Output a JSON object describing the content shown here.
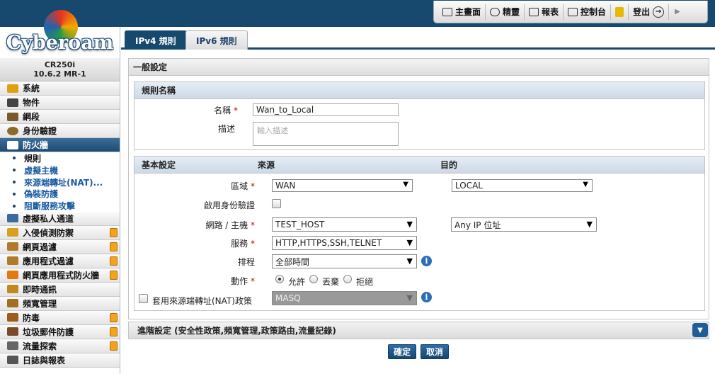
{
  "toolbar": {
    "items": [
      {
        "label": "主畫面",
        "icon": "monitor-icon"
      },
      {
        "label": "精靈",
        "icon": "chat-icon"
      },
      {
        "label": "報表",
        "icon": "report-icon"
      },
      {
        "label": "控制台",
        "icon": "console-icon"
      },
      {
        "label": "",
        "icon": "lock-icon"
      },
      {
        "label": "登出",
        "icon": "logout-icon"
      }
    ]
  },
  "logo": {
    "text": "Cyberoam"
  },
  "device": {
    "model": "CR250i",
    "version": "10.6.2 MR-1"
  },
  "menu": [
    {
      "label": "系統",
      "icon": "system-icon",
      "color": "#e0a010"
    },
    {
      "label": "物件",
      "icon": "objects-icon",
      "color": "#444"
    },
    {
      "label": "網段",
      "icon": "network-icon",
      "color": "#7a5a2a"
    },
    {
      "label": "身份驗證",
      "icon": "identity-icon",
      "color": "#8a6a2a"
    },
    {
      "label": "防火牆",
      "icon": "firewall-icon",
      "color": "#fff"
    }
  ],
  "submenu": [
    "規則",
    "虛擬主機",
    "來源端轉址(NAT)...",
    "偽裝防護",
    "阻斷服務攻擊"
  ],
  "menu2": [
    {
      "label": "虛擬私人通道",
      "icon": "vpn-icon",
      "color": "#3a6aa0",
      "locked": false
    },
    {
      "label": "入侵偵測防禦",
      "icon": "ips-icon",
      "color": "#d8a020",
      "locked": true
    },
    {
      "label": "網頁過濾",
      "icon": "web-filter-icon",
      "color": "#b07a2a",
      "locked": true
    },
    {
      "label": "應用程式過濾",
      "icon": "app-filter-icon",
      "color": "#b07a2a",
      "locked": true
    },
    {
      "label": "網頁應用程式防火牆",
      "icon": "waf-icon",
      "color": "#e07a10",
      "locked": true
    },
    {
      "label": "即時通訊",
      "icon": "im-icon",
      "color": "#c08a20",
      "locked": false
    },
    {
      "label": "頻寬管理",
      "icon": "bandwidth-icon",
      "color": "#a07020",
      "locked": false
    },
    {
      "label": "防毒",
      "icon": "antivirus-icon",
      "color": "#a05a1a",
      "locked": true
    },
    {
      "label": "垃圾郵件防護",
      "icon": "antispam-icon",
      "color": "#7a4a2a",
      "locked": true
    },
    {
      "label": "流量探索",
      "icon": "traffic-icon",
      "color": "#666",
      "locked": true
    },
    {
      "label": "日誌與報表",
      "icon": "logs-icon",
      "color": "#555",
      "locked": false
    }
  ],
  "tabs": [
    "IPv4 規則",
    "IPv6 規則"
  ],
  "general": {
    "title": "一般設定"
  },
  "rulename": {
    "section": "規則名稱",
    "name_label": "名稱",
    "name_value": "Wan_to_Local",
    "desc_label": "描述",
    "desc_placeholder": "輸入描述"
  },
  "basic": {
    "section": "基本設定",
    "source_col": "來源",
    "dest_col": "目的",
    "zone_label": "區域",
    "src_zone": "WAN",
    "dst_zone": "LOCAL",
    "identity_label": "啟用身份驗證",
    "network_label": "網路 / 主機",
    "src_network": "TEST_HOST",
    "dst_network": "Any IP 位址",
    "service_label": "服務",
    "service_value": "HTTP,HTTPS,SSH,TELNET",
    "schedule_label": "排程",
    "schedule_value": "全部時間",
    "action_label": "動作",
    "actions": [
      "允許",
      "丟棄",
      "拒絕"
    ],
    "selected_action": "允許",
    "nat_label": "套用來源端轉址(NAT)政策",
    "nat_value": "MASQ"
  },
  "advanced": {
    "label": "進階設定 (安全性政策,頻寬管理,政策路由,流量記錄)"
  },
  "buttons": {
    "ok": "確定",
    "cancel": "取消"
  }
}
